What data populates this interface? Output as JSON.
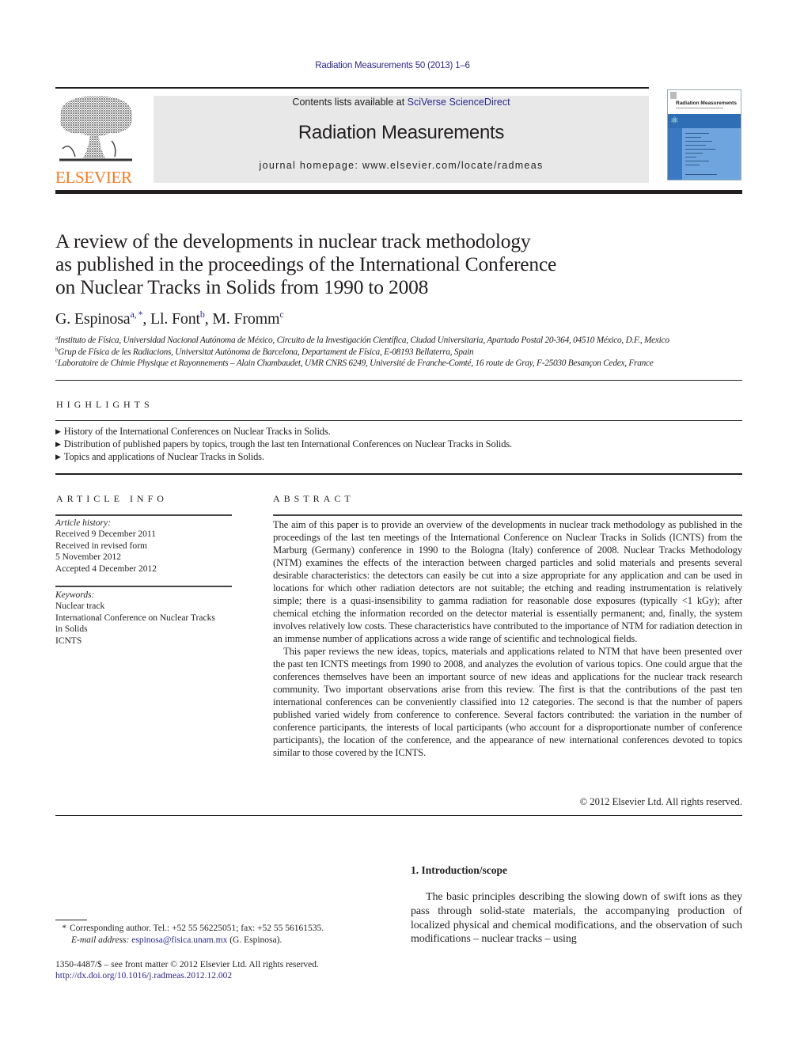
{
  "header": {
    "citation": "Radiation Measurements 50 (2013) 1–6",
    "publisher_logo_text": "ELSEVIER",
    "contents_prefix": "Contents lists available at ",
    "contents_link": "SciVerse ScienceDirect",
    "journal_title": "Radiation Measurements",
    "homepage_prefix": "journal homepage: ",
    "homepage_url": "www.elsevier.com/locate/radmeas",
    "cover_title": "Radiation Measurements",
    "icons": {
      "publisher_logo": "elsevier-tree-logo",
      "cover": "journal-cover-thumbnail",
      "cover_atom": "atom-icon"
    }
  },
  "article": {
    "title": "A review of the developments in nuclear track methodology as published in the proceedings of the International Conference on Nuclear Tracks in Solids from 1990 to 2008",
    "title_lines": [
      "A review of the developments in nuclear track methodology",
      "as published in the proceedings of the International Conference",
      "on Nuclear Tracks in Solids from 1990 to 2008"
    ],
    "authors": [
      {
        "name": "G. Espinosa",
        "affil": "a, *"
      },
      {
        "name": "Ll. Font",
        "affil": "b"
      },
      {
        "name": "M. Fromm",
        "affil": "c"
      }
    ],
    "author_separator": ", ",
    "affiliations": [
      {
        "mark": "a",
        "text": "Instituto de Física, Universidad Nacional Autónoma de México, Circuito de la Investigación Científica, Ciudad Universitaria, Apartado Postal 20-364, 04510 México, D.F., Mexico"
      },
      {
        "mark": "b",
        "text": "Grup de Física de les Radiacions, Universitat Autònoma de Barcelona, Departament de Física, E-08193 Bellaterra, Spain"
      },
      {
        "mark": "c",
        "text": "Laboratoire de Chimie Physique et Rayonnements – Alain Chambaudet, UMR CNRS 6249, Université de Franche-Comté, 16 route de Gray, F-25030 Besançon Cedex, France"
      }
    ]
  },
  "highlights": {
    "heading": "HIGHLIGHTS",
    "bullet": "▶",
    "items": [
      "History of the International Conferences on Nuclear Tracks in Solids.",
      "Distribution of published papers by topics, trough the last ten International Conferences on Nuclear Tracks in Solids.",
      "Topics and applications of Nuclear Tracks in Solids."
    ]
  },
  "article_info": {
    "heading": "ARTICLE INFO",
    "history_label": "Article history:",
    "history": [
      "Received 9 December 2011",
      "Received in revised form",
      "5 November 2012",
      "Accepted 4 December 2012"
    ],
    "keywords_label": "Keywords:",
    "keywords": [
      "Nuclear track",
      "International Conference on Nuclear Tracks",
      "in Solids",
      "ICNTS"
    ]
  },
  "abstract": {
    "heading": "ABSTRACT",
    "paragraphs": [
      "The aim of this paper is to provide an overview of the developments in nuclear track methodology as published in the proceedings of the last ten meetings of the International Conference on Nuclear Tracks in Solids (ICNTS) from the Marburg (Germany) conference in 1990 to the Bologna (Italy) conference of 2008. Nuclear Tracks Methodology (NTM) examines the effects of the interaction between charged particles and solid materials and presents several desirable characteristics: the detectors can easily be cut into a size appropriate for any application and can be used in locations for which other radiation detectors are not suitable; the etching and reading instrumentation is relatively simple; there is a quasi-insensibility to gamma radiation for reasonable dose exposures (typically <1 kGy); after chemical etching the information recorded on the detector material is essentially permanent; and, finally, the system involves relatively low costs. These characteristics have contributed to the importance of NTM for radiation detection in an immense number of applications across a wide range of scientific and technological fields.",
      "This paper reviews the new ideas, topics, materials and applications related to NTM that have been presented over the past ten ICNTS meetings from 1990 to 2008, and analyzes the evolution of various topics. One could argue that the conferences themselves have been an important source of new ideas and applications for the nuclear track research community. Two important observations arise from this review. The first is that the contributions of the past ten international conferences can be conveniently classified into 12 categories. The second is that the number of papers published varied widely from conference to conference. Several factors contributed: the variation in the number of conference participants, the interests of local participants (who account for a disproportionate number of conference participants), the location of the conference, and the appearance of new international conferences devoted to topics similar to those covered by the ICNTS."
    ],
    "copyright": "© 2012 Elsevier Ltd. All rights reserved."
  },
  "introduction": {
    "heading": "1.  Introduction/scope",
    "text": "The basic principles describing the slowing down of swift ions as they pass through solid-state materials, the accompanying production of localized physical and chemical modifications, and the observation of such modifications – nuclear tracks – using"
  },
  "footnotes": {
    "corresponding_mark": "*",
    "corresponding_text": "Corresponding author. Tel.: +52 55 56225051; fax: +52 55 56161535.",
    "email_label": "E-mail address:",
    "email": "espinosa@fisica.unam.mx",
    "email_suffix": " (G. Espinosa).",
    "issn_line": "1350-4487/$ – see front matter © 2012 Elsevier Ltd. All rights reserved.",
    "doi": "http://dx.doi.org/10.1016/j.radmeas.2012.12.002"
  }
}
